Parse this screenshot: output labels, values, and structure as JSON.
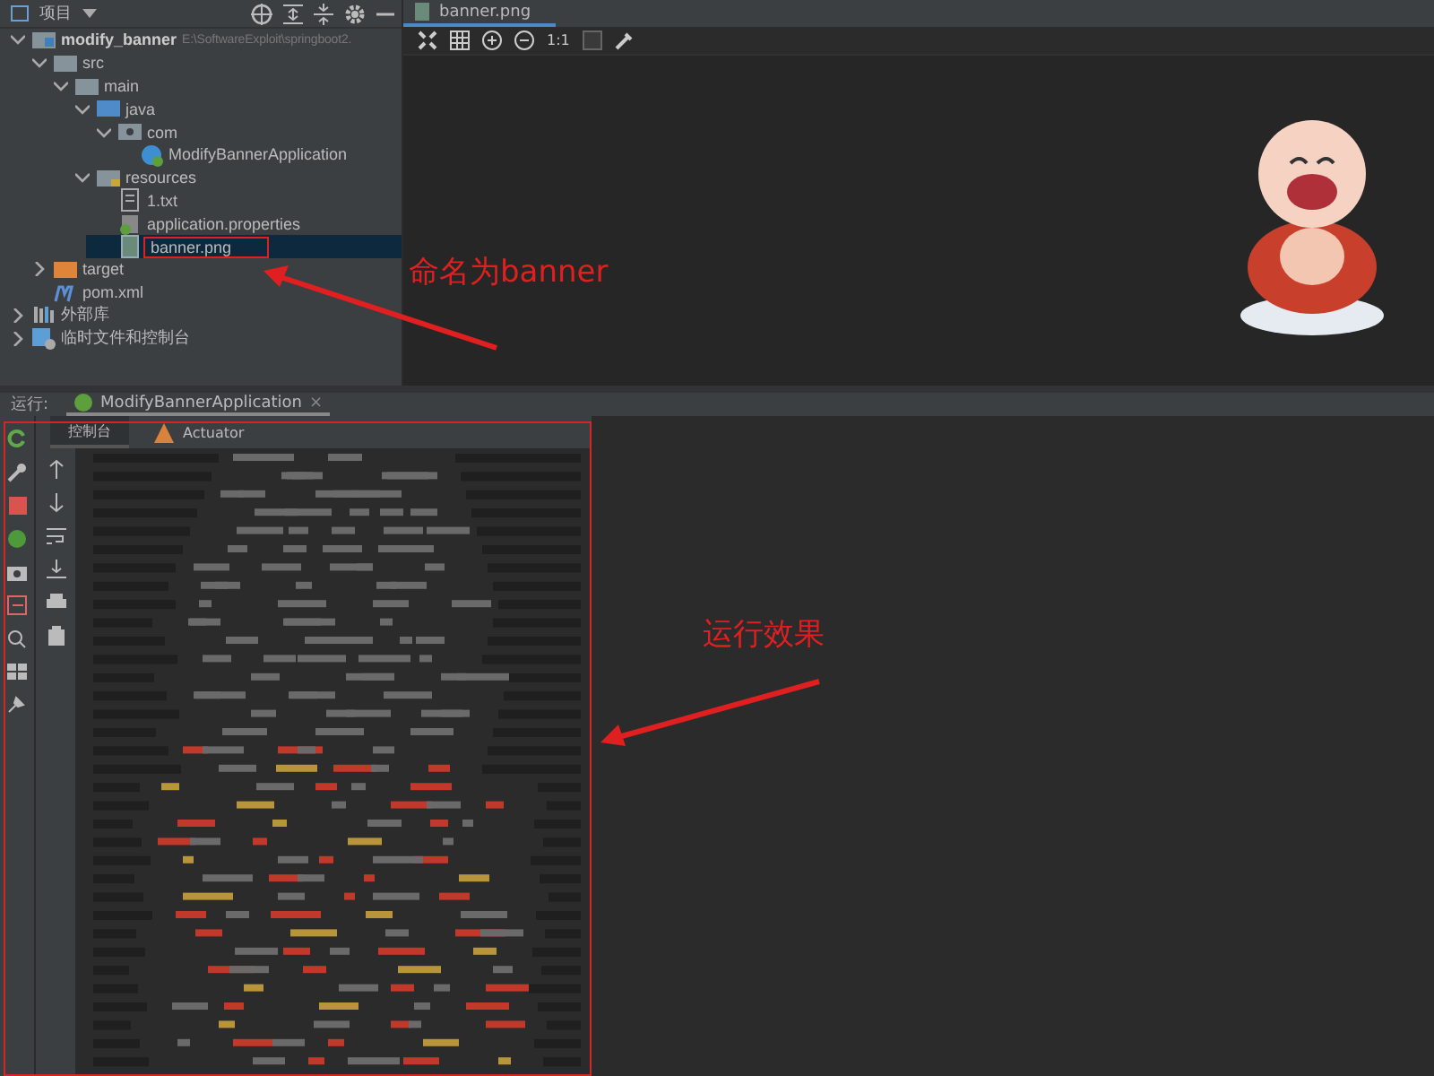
{
  "project_panel": {
    "title": "项目",
    "tree": [
      {
        "kind": "module",
        "label": "modify_banner",
        "path": "E:\\SoftwareExploit\\springboot2.",
        "expanded": true,
        "selected": false,
        "children": [
          {
            "kind": "folder",
            "label": "src",
            "expanded": true,
            "selected": false,
            "children": [
              {
                "kind": "folder",
                "label": "main",
                "expanded": true,
                "selected": false,
                "children": [
                  {
                    "kind": "source",
                    "label": "java",
                    "expanded": true,
                    "selected": false,
                    "children": [
                      {
                        "kind": "package",
                        "label": "com",
                        "expanded": true,
                        "selected": false,
                        "children": [
                          {
                            "kind": "class",
                            "label": "ModifyBannerApplication",
                            "selected": false
                          }
                        ]
                      }
                    ]
                  },
                  {
                    "kind": "resources",
                    "label": "resources",
                    "expanded": true,
                    "selected": false,
                    "children": [
                      {
                        "kind": "text",
                        "label": "1.txt",
                        "selected": false
                      },
                      {
                        "kind": "properties",
                        "label": "application.properties",
                        "selected": false
                      },
                      {
                        "kind": "image",
                        "label": "banner.png",
                        "selected": true,
                        "highlighted": true
                      }
                    ]
                  }
                ]
              }
            ]
          },
          {
            "kind": "excluded",
            "label": "target",
            "expanded": false,
            "selected": false
          },
          {
            "kind": "maven",
            "label": "pom.xml",
            "selected": false
          }
        ]
      },
      {
        "kind": "library",
        "label": "外部库",
        "expanded": false,
        "selected": false
      },
      {
        "kind": "scratch",
        "label": "临时文件和控制台",
        "expanded": false,
        "selected": false
      }
    ]
  },
  "editor": {
    "tab": "banner.png",
    "zoom_label": "1:1"
  },
  "run_panel": {
    "label": "运行:",
    "tab": "ModifyBannerApplication",
    "close": "×",
    "tabs": [
      {
        "label": "控制台",
        "selected": true
      },
      {
        "label": "Actuator",
        "selected": false
      }
    ]
  },
  "annotations": [
    {
      "text": "命名为banner"
    },
    {
      "text": "运行效果"
    }
  ]
}
